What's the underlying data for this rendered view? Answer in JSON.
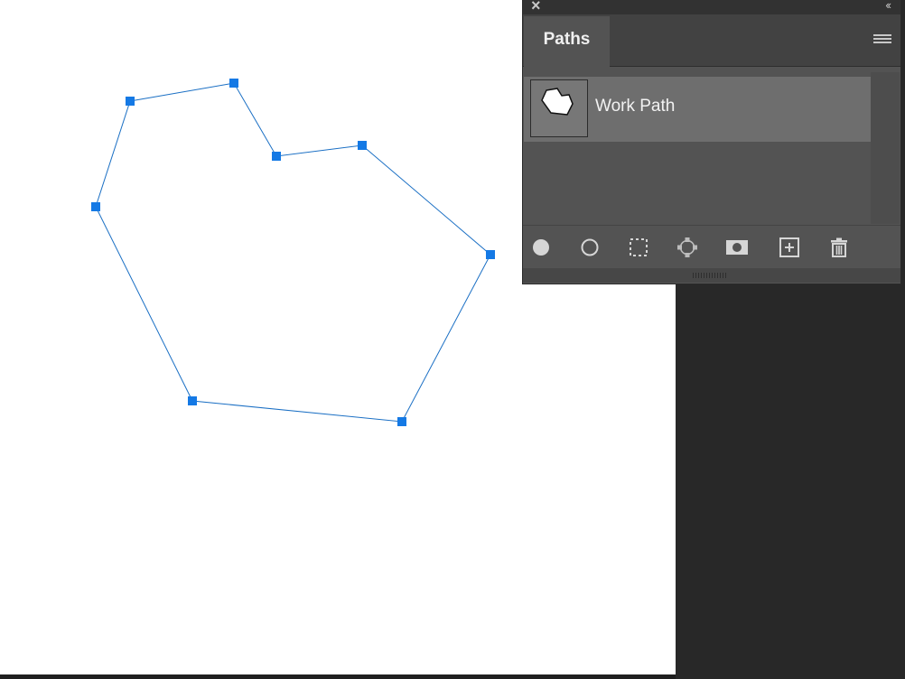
{
  "panel": {
    "title": "Paths",
    "close_icon": "×",
    "collapse_icon": "‹‹",
    "menu_icon": "hamburger-menu-icon"
  },
  "paths": [
    {
      "name": "Work Path",
      "selected": true
    }
  ],
  "toolbar": {
    "icons": [
      "fill-path-icon",
      "stroke-path-icon",
      "load-as-selection-icon",
      "make-work-path-icon",
      "add-mask-icon",
      "create-new-path-icon",
      "delete-path-icon"
    ]
  },
  "colors": {
    "anchor": "#1479e5",
    "path_stroke": "#1a6fc4",
    "panel_bg": "#535353",
    "selected_row": "#6e6e6e"
  }
}
